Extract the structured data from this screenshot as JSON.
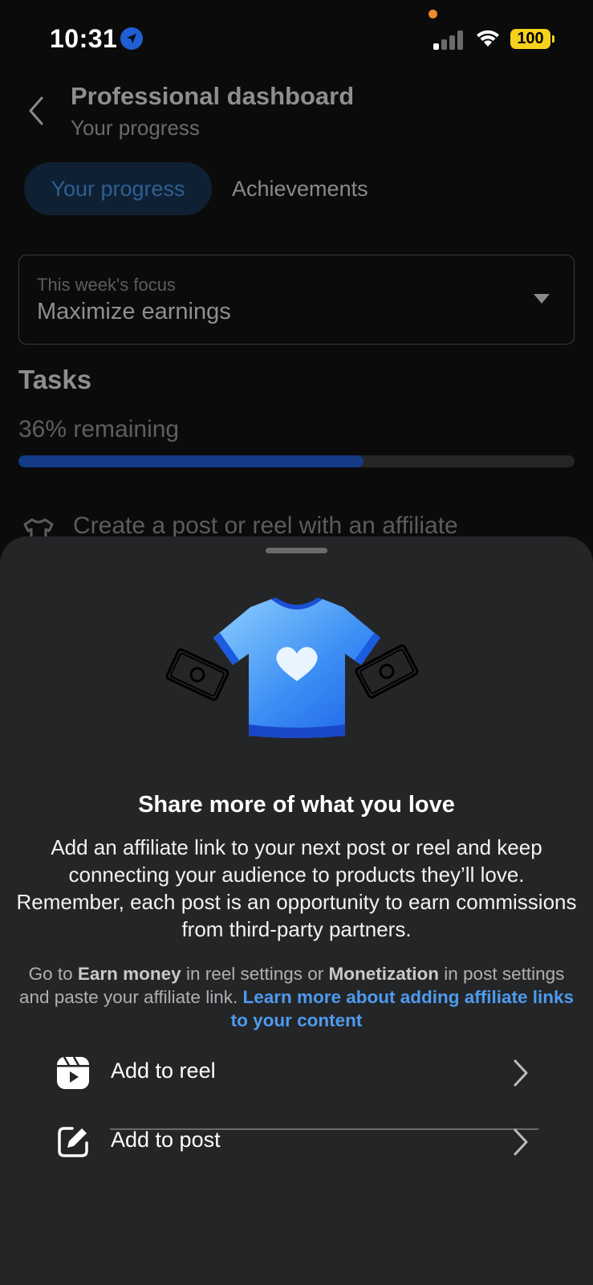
{
  "status_bar": {
    "time": "10:31",
    "battery": "100"
  },
  "header": {
    "title": "Professional dashboard",
    "subtitle": "Your progress"
  },
  "tabs": [
    {
      "label": "Your progress",
      "active": true
    },
    {
      "label": "Achievements",
      "active": false
    }
  ],
  "focus_select": {
    "label": "This week's focus",
    "value": "Maximize earnings"
  },
  "tasks": {
    "title": "Tasks",
    "remaining_text": "36% remaining",
    "progress_fraction": 0.62,
    "first_task": "Create a post or reel with an affiliate"
  },
  "sheet": {
    "title": "Share more of what you love",
    "body": "Add an affiliate link to your next post or reel and keep connecting your audience to products they’ll love. Remember, each post is an opportunity to earn commissions from third-party partners.",
    "note_prefix": "Go to ",
    "note_earn": "Earn money",
    "note_mid": " in reel settings or ",
    "note_monetization": "Monetization",
    "note_suffix": " in post settings and paste your affiliate link. ",
    "note_link": "Learn more about adding affiliate links to your content",
    "actions": [
      {
        "label": "Add to reel",
        "icon": "reel-icon"
      },
      {
        "label": "Add to post",
        "icon": "edit-post-icon"
      }
    ]
  },
  "colors": {
    "accent_link": "#4e9bf0",
    "progress_fill": "#123a86",
    "sheet_bg": "#242527",
    "battery": "#f5d31d"
  }
}
